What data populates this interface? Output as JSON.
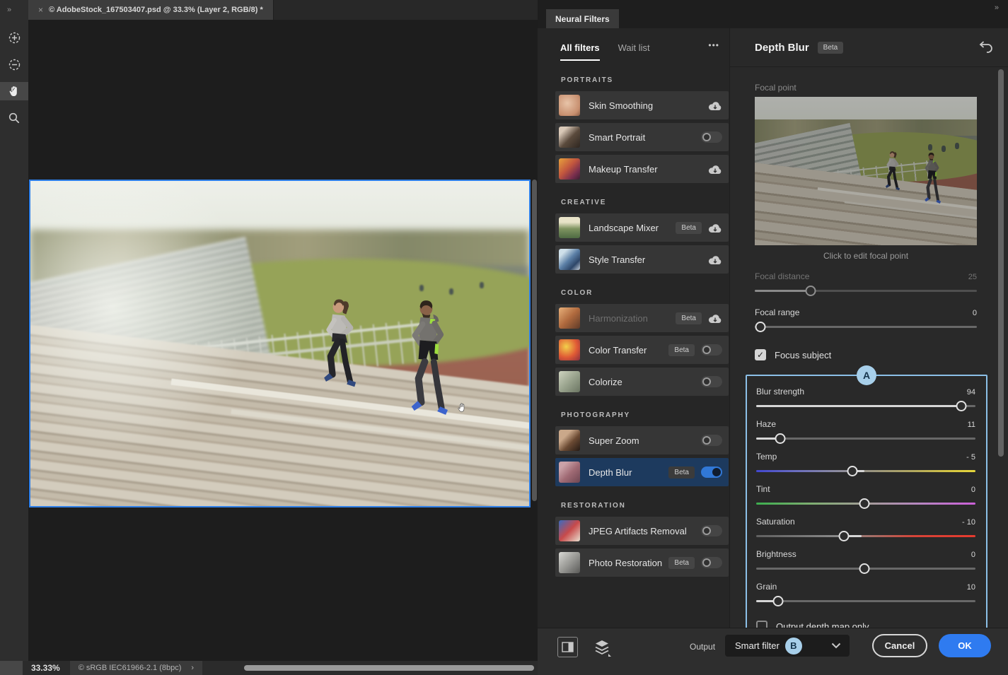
{
  "window": {
    "collapse_left": "»",
    "doc_tab": {
      "close": "×",
      "title": "© AdobeStock_167503407.psd @ 33.3% (Layer 2, RGB/8) *"
    },
    "status": {
      "zoom_level": "33.33%",
      "color_profile": "© sRGB IEC61966-2.1 (8bpc)",
      "expand": "›"
    },
    "tool_icons": [
      "add-selection-icon",
      "subtract-selection-icon",
      "hand-tool-icon",
      "zoom-tool-icon"
    ]
  },
  "panel": {
    "tab_title": "Neural Filters",
    "collapse_right": "»",
    "tabs": {
      "all": "All filters",
      "wait": "Wait list",
      "more": "•••"
    },
    "sections": [
      {
        "title": "PORTRAITS",
        "items": [
          {
            "label": "Skin Smoothing",
            "control": "download"
          },
          {
            "label": "Smart Portrait",
            "control": "toggle-off"
          },
          {
            "label": "Makeup Transfer",
            "control": "download"
          }
        ]
      },
      {
        "title": "CREATIVE",
        "items": [
          {
            "label": "Landscape Mixer",
            "beta": "Beta",
            "control": "download"
          },
          {
            "label": "Style Transfer",
            "control": "download"
          }
        ]
      },
      {
        "title": "COLOR",
        "items": [
          {
            "label": "Harmonization",
            "beta": "Beta",
            "control": "download",
            "disabled": true
          },
          {
            "label": "Color Transfer",
            "beta": "Beta",
            "control": "toggle-off"
          },
          {
            "label": "Colorize",
            "control": "toggle-off"
          }
        ]
      },
      {
        "title": "PHOTOGRAPHY",
        "items": [
          {
            "label": "Super Zoom",
            "control": "toggle-off"
          },
          {
            "label": "Depth Blur",
            "beta": "Beta",
            "control": "toggle-on",
            "selected": true
          }
        ]
      },
      {
        "title": "RESTORATION",
        "items": [
          {
            "label": "JPEG Artifacts Removal",
            "control": "toggle-off"
          },
          {
            "label": "Photo Restoration",
            "beta": "Beta",
            "control": "toggle-off"
          }
        ]
      }
    ]
  },
  "settings": {
    "title": "Depth Blur",
    "beta": "Beta",
    "reset_icon": "reset-icon",
    "focal_point": {
      "label": "Focal point",
      "hint": "Click to edit focal point"
    },
    "focal_distance": {
      "label": "Focal distance",
      "value": "25"
    },
    "focal_range": {
      "label": "Focal range",
      "value": "0"
    },
    "focus_subject": {
      "label": "Focus subject",
      "checked": true,
      "check": "✓"
    },
    "sliders": [
      {
        "label": "Blur strength",
        "value": "94"
      },
      {
        "label": "Haze",
        "value": "11"
      },
      {
        "label": "Temp",
        "value": "- 5"
      },
      {
        "label": "Tint",
        "value": "0"
      },
      {
        "label": "Saturation",
        "value": "- 10"
      },
      {
        "label": "Brightness",
        "value": "0"
      },
      {
        "label": "Grain",
        "value": "10"
      }
    ],
    "output_depth_map": {
      "label": "Output depth map only",
      "checked": false
    },
    "annotations": {
      "a": "A",
      "b": "B"
    }
  },
  "footer": {
    "output_label": "Output",
    "output_value": "Smart filter",
    "cancel": "Cancel",
    "ok": "OK",
    "icons": [
      "split-preview-icon",
      "layers-icon",
      "chevron-down-icon"
    ]
  },
  "colors": {
    "accent_blue": "#2f7bf0",
    "selection_row_blue": "#1d3a5e",
    "toggle_on_blue": "#3178d6",
    "annotation_blue": "#a7cfea",
    "image_selection_border": "#2e7fe8"
  }
}
